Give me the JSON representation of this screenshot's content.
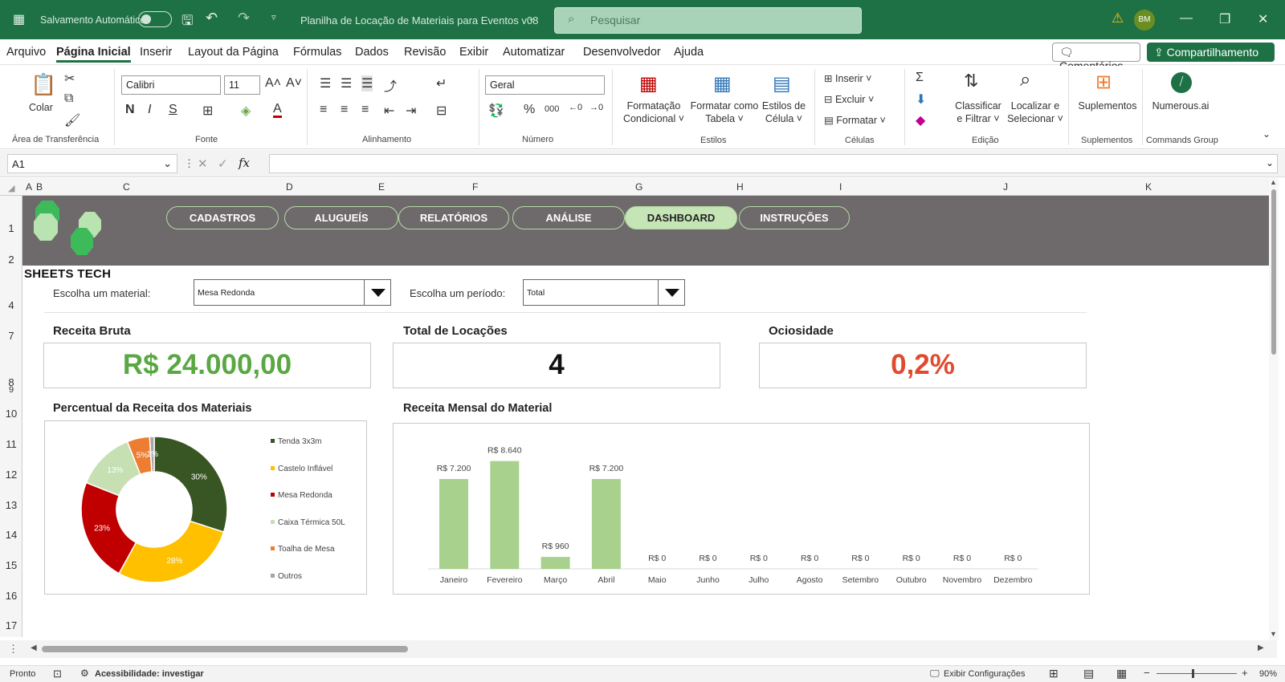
{
  "titlebar": {
    "autosave": "Salvamento Automático",
    "filename": "Planilha de Locação de Materiais para Eventos v08",
    "search_placeholder": "Pesquisar",
    "user_initials": "BM"
  },
  "menu": {
    "items": [
      "Arquivo",
      "Página Inicial",
      "Inserir",
      "Layout da Página",
      "Fórmulas",
      "Dados",
      "Revisão",
      "Exibir",
      "Automatizar",
      "Desenvolvedor",
      "Ajuda"
    ],
    "comments": "Comentários",
    "share": "Compartilhamento"
  },
  "ribbon": {
    "clipboard": {
      "paste": "Colar",
      "group": "Área de Transferência"
    },
    "font": {
      "name": "Calibri",
      "size": "11",
      "group": "Fonte"
    },
    "alignment": {
      "group": "Alinhamento"
    },
    "number": {
      "format": "Geral",
      "group": "Número"
    },
    "styles": {
      "cond1": "Formatação",
      "cond2": "Condicional",
      "table1": "Formatar como",
      "table2": "Tabela",
      "cell1": "Estilos de",
      "cell2": "Célula",
      "group": "Estilos"
    },
    "cells": {
      "insert": "Inserir",
      "delete": "Excluir",
      "format": "Formatar",
      "group": "Células"
    },
    "editing": {
      "sort1": "Classificar",
      "sort2": "e Filtrar",
      "find1": "Localizar e",
      "find2": "Selecionar",
      "group": "Edição"
    },
    "addins": {
      "label": "Suplementos",
      "group": "Suplementos"
    },
    "numerous": {
      "label": "Numerous.ai",
      "group": "Commands Group"
    }
  },
  "formula": {
    "cell_ref": "A1",
    "content": ""
  },
  "columns": [
    "A",
    "B",
    "C",
    "D",
    "E",
    "F",
    "G",
    "H",
    "I",
    "J",
    "K"
  ],
  "rows": [
    "1",
    "2",
    "4",
    "7",
    "8",
    "9",
    "10",
    "11",
    "12",
    "13",
    "14",
    "15",
    "16",
    "17"
  ],
  "dashboard": {
    "logo_text": "SHEETS TECH",
    "nav": [
      "CADASTROS",
      "ALUGUEÍS",
      "RELATÓRIOS",
      "ANÁLISE",
      "DASHBOARD",
      "INSTRUÇÕES"
    ],
    "material_label": "Escolha um material:",
    "material_value": "Mesa Redonda",
    "period_label": "Escolha um período:",
    "period_value": "Total",
    "kpi": [
      {
        "title": "Receita Bruta",
        "value": "R$ 24.000,00",
        "color": "#5aa843"
      },
      {
        "title": "Total de Locações",
        "value": "4",
        "color": "#111111"
      },
      {
        "title": "Ociosidade",
        "value": "0,2%",
        "color": "#e04b2f"
      }
    ]
  },
  "chart_data": [
    {
      "type": "pie",
      "title": "Percentual da Receita dos Materiais",
      "variant": "donut",
      "labels": [
        "Tenda 3x3m",
        "Castelo Inflável",
        "Mesa Redonda",
        "Caixa Térmica 50L",
        "Toalha de Mesa",
        "Outros"
      ],
      "values": [
        30,
        28,
        23,
        13,
        5,
        1
      ],
      "data_labels": [
        "30%",
        "28%",
        "23%",
        "13%",
        "5%",
        "1%"
      ],
      "colors": [
        "#375623",
        "#ffc000",
        "#c00000",
        "#c6e0b4",
        "#ed7d31",
        "#a6a6a6"
      ],
      "legend": "right"
    },
    {
      "type": "bar",
      "title": "Receita Mensal do Material",
      "categories": [
        "Janeiro",
        "Fevereiro",
        "Março",
        "Abril",
        "Maio",
        "Junho",
        "Julho",
        "Agosto",
        "Setembro",
        "Outubro",
        "Novembro",
        "Dezembro"
      ],
      "values": [
        7200,
        8640,
        960,
        7200,
        0,
        0,
        0,
        0,
        0,
        0,
        0,
        0
      ],
      "data_labels": [
        "R$ 7.200",
        "R$ 8.640",
        "R$ 960",
        "R$ 7.200",
        "R$ 0",
        "R$ 0",
        "R$ 0",
        "R$ 0",
        "R$ 0",
        "R$ 0",
        "R$ 0",
        "R$ 0"
      ],
      "ylim": [
        0,
        9000
      ],
      "grid": false,
      "color": "#a9d18e"
    }
  ],
  "status": {
    "ready": "Pronto",
    "accessibility": "Acessibilidade: investigar",
    "display_settings": "Exibir Configurações",
    "zoom": "90%"
  }
}
